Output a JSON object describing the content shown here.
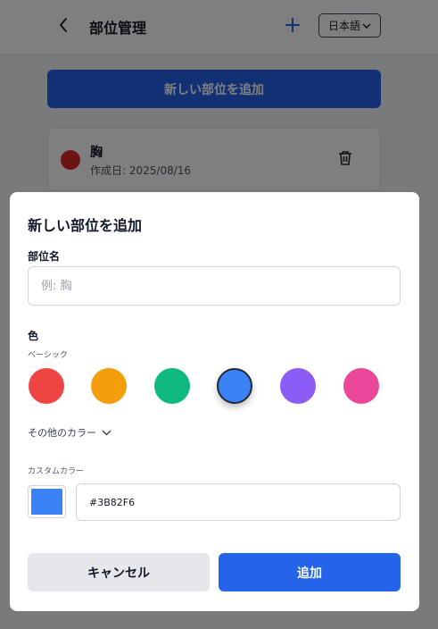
{
  "header": {
    "title": "部位管理",
    "plus_label": "+",
    "language": "日本語"
  },
  "main": {
    "add_button_label": "新しい部位を追加",
    "parts": [
      {
        "name": "胸",
        "created": "作成日: 2025/08/16",
        "color": "#dc2626"
      }
    ]
  },
  "modal": {
    "title": "新しい部位を追加",
    "name_label": "部位名",
    "name_placeholder": "例: 胸",
    "name_value": "",
    "color_label": "色",
    "basic_label": "ベーシック",
    "basic_colors": [
      "#ef4444",
      "#f59e0b",
      "#10b981",
      "#3b82f6",
      "#8b5cf6",
      "#ec4899"
    ],
    "selected_color": "#3b82f6",
    "more_colors_label": "その他のカラー",
    "custom_label": "カスタムカラー",
    "hex_value": "#3B82F6",
    "cancel_label": "キャンセル",
    "confirm_label": "追加"
  },
  "icons": [
    "chevron-left-icon",
    "plus-icon",
    "chevron-down-icon",
    "trash-icon"
  ]
}
